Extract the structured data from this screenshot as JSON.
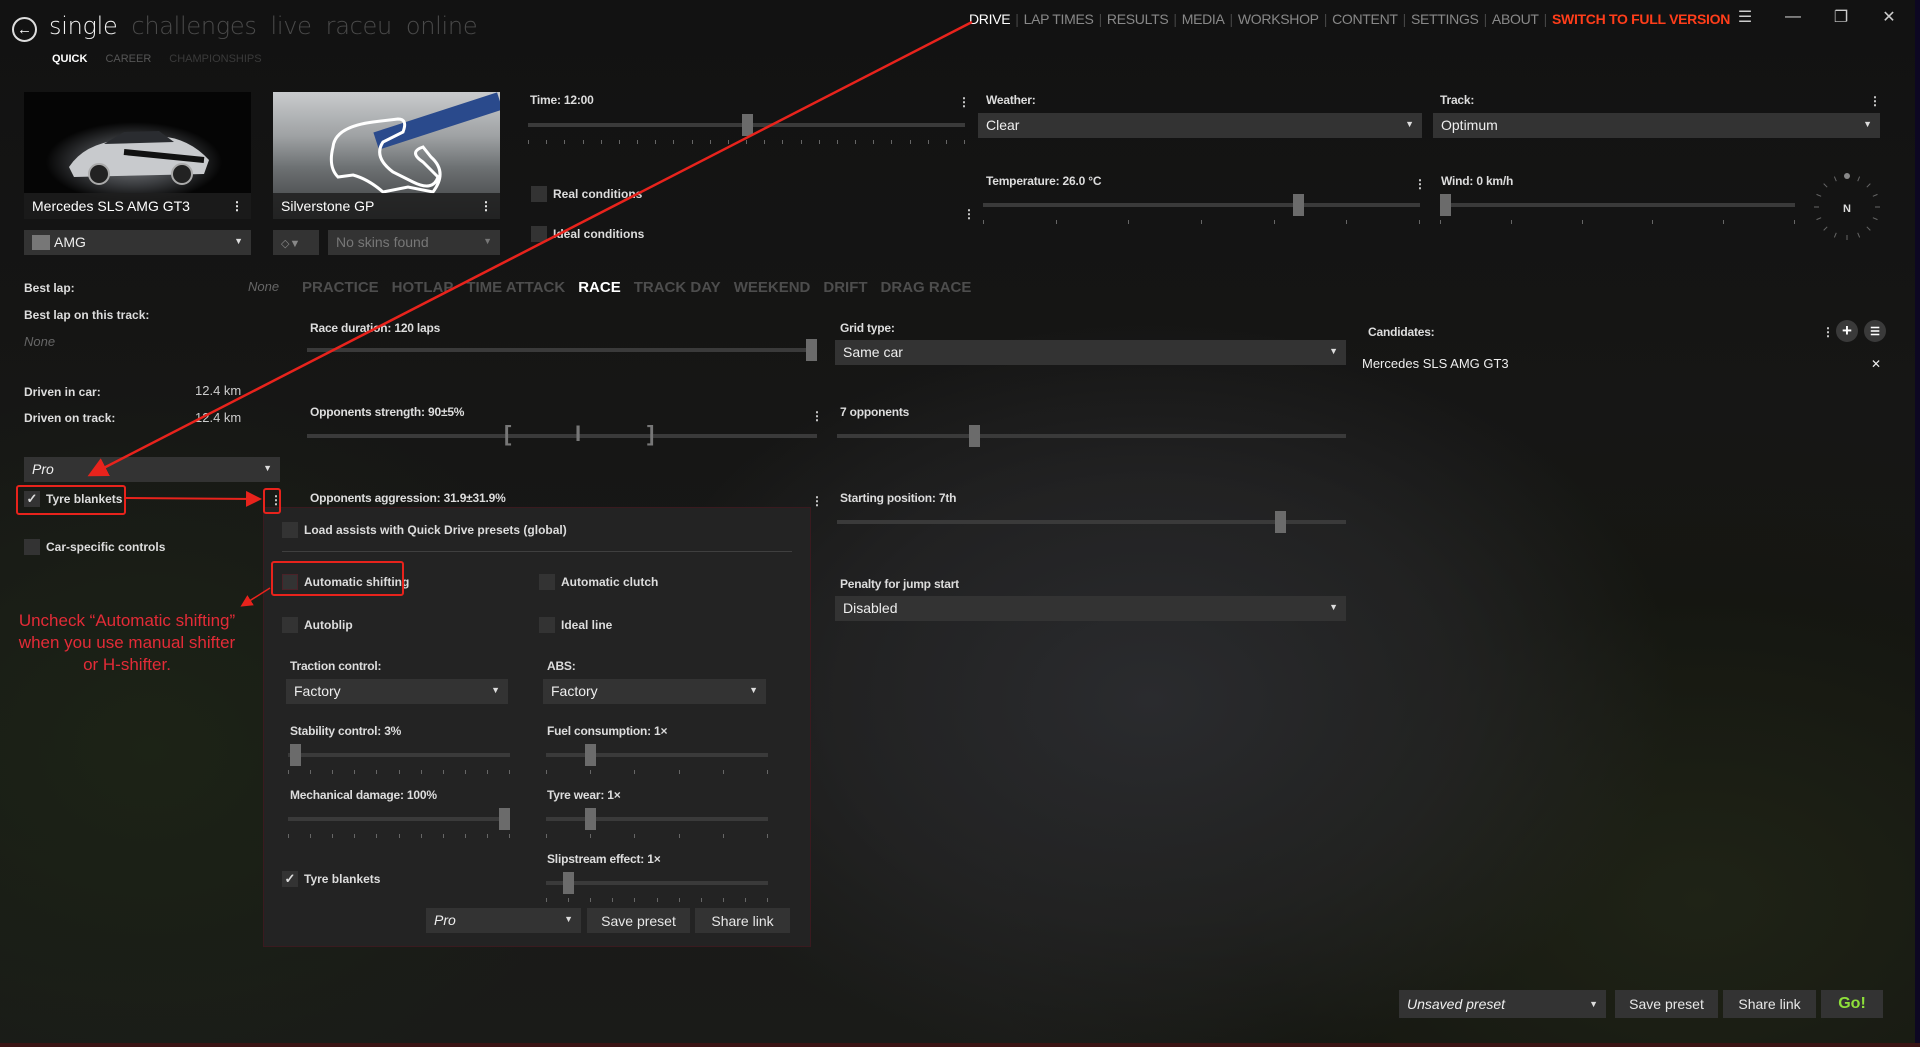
{
  "header": {
    "back_icon": "arrow-left-circle-icon",
    "main_tabs": [
      {
        "label": "single",
        "active": true
      },
      {
        "label": "challenges",
        "active": false
      },
      {
        "label": "live",
        "active": false
      },
      {
        "label": "raceu",
        "active": false
      },
      {
        "label": "online",
        "active": false
      }
    ],
    "sub_tabs": [
      {
        "label": "QUICK",
        "active": true
      },
      {
        "label": "CAREER",
        "active": false
      },
      {
        "label": "CHAMPIONSHIPS",
        "active": false
      }
    ],
    "menu": [
      {
        "label": "DRIVE",
        "active": true
      },
      {
        "label": "LAP TIMES"
      },
      {
        "label": "RESULTS"
      },
      {
        "label": "MEDIA"
      },
      {
        "label": "WORKSHOP"
      },
      {
        "label": "CONTENT"
      },
      {
        "label": "SETTINGS"
      },
      {
        "label": "ABOUT"
      },
      {
        "label": "SWITCH TO FULL VERSION",
        "highlight": true
      }
    ],
    "window_controls": {
      "menu": "☰",
      "minimize": "—",
      "restore": "❐",
      "close": "✕"
    }
  },
  "car": {
    "name": "Mercedes SLS AMG GT3",
    "skin": "AMG"
  },
  "track": {
    "name": "Silverstone GP",
    "layout_icon": "track-layout-icon",
    "skins_placeholder": "No skins found"
  },
  "conditions": {
    "time_label": "Time: 12:00",
    "time_value_fraction": 0.5,
    "real_conditions": {
      "label": "Real conditions",
      "checked": false
    },
    "ideal_conditions": {
      "label": "Ideal conditions",
      "checked": false
    },
    "weather_label": "Weather:",
    "weather_value": "Clear",
    "track_label": "Track:",
    "track_value": "Optimum",
    "temperature_label": "Temperature: 26.0 °C",
    "temperature_fraction": 0.72,
    "wind_label": "Wind: 0 km/h",
    "wind_fraction": 0.0,
    "compass_label": "N"
  },
  "stats": {
    "best_lap_label": "Best lap:",
    "best_lap_value": "None",
    "best_lap_track_label": "Best lap on this track:",
    "best_lap_track_value": "None",
    "driven_car_label": "Driven in car:",
    "driven_car_value": "12.4 km",
    "driven_track_label": "Driven on track:",
    "driven_track_value": "12.4 km"
  },
  "assists_preset": "Pro",
  "tyre_blankets": {
    "label": "Tyre blankets",
    "checked": true
  },
  "car_specific_controls": {
    "label": "Car-specific controls",
    "checked": false
  },
  "modes": [
    {
      "label": "PRACTICE"
    },
    {
      "label": "HOTLAP"
    },
    {
      "label": "TIME ATTACK"
    },
    {
      "label": "RACE",
      "active": true
    },
    {
      "label": "TRACK DAY"
    },
    {
      "label": "WEEKEND"
    },
    {
      "label": "DRIFT"
    },
    {
      "label": "DRAG RACE"
    }
  ],
  "race": {
    "duration_label": "Race duration: 120 laps",
    "duration_fraction": 1.0,
    "strength_label": "Opponents strength: 90±5%",
    "strength_value": 90,
    "strength_range": [
      85,
      95
    ],
    "aggression_label": "Opponents aggression: 31.9±31.9%",
    "grid_type_label": "Grid type:",
    "grid_type_value": "Same car",
    "opponents_label": "7 opponents",
    "opponents_fraction": 0.27,
    "starting_position_label": "Starting position: 7th",
    "starting_position_fraction": 0.87,
    "penalty_label": "Penalty for jump start",
    "penalty_value": "Disabled"
  },
  "candidates": {
    "label": "Candidates:",
    "items": [
      "Mercedes SLS AMG GT3"
    ],
    "remove_icon": "✕"
  },
  "assists_popup": {
    "load_assists": {
      "label": "Load assists with Quick Drive presets (global)",
      "checked": false
    },
    "automatic_shifting": {
      "label": "Automatic shifting",
      "checked": false
    },
    "automatic_clutch": {
      "label": "Automatic clutch",
      "checked": false
    },
    "autoblip": {
      "label": "Autoblip",
      "checked": false
    },
    "ideal_line": {
      "label": "Ideal line",
      "checked": false
    },
    "traction_label": "Traction control:",
    "traction_value": "Factory",
    "abs_label": "ABS:",
    "abs_value": "Factory",
    "stability_label": "Stability control: 3%",
    "stability_fraction": 0.03,
    "fuel_label": "Fuel consumption: 1×",
    "fuel_fraction": 0.2,
    "damage_label": "Mechanical damage: 100%",
    "damage_fraction": 1.0,
    "tyre_wear_label": "Tyre wear: 1×",
    "tyre_wear_fraction": 0.2,
    "slipstream_label": "Slipstream effect: 1×",
    "slipstream_fraction": 0.1,
    "tyre_blankets": {
      "label": "Tyre blankets",
      "checked": true
    },
    "preset_value": "Pro",
    "save_preset": "Save preset",
    "share_link": "Share link"
  },
  "annotation": {
    "text_line1": "Uncheck “Automatic shifting”",
    "text_line2": "when you use manual shifter",
    "text_line3": "or H-shifter.",
    "color": "#e32b37"
  },
  "footer": {
    "preset_value": "Unsaved preset",
    "save_preset": "Save preset",
    "share_link": "Share link",
    "go": "Go!"
  },
  "colors": {
    "accent_cta": "#ff3d1a",
    "go_green": "#8ee03a",
    "annotation_red": "#e8231c"
  }
}
